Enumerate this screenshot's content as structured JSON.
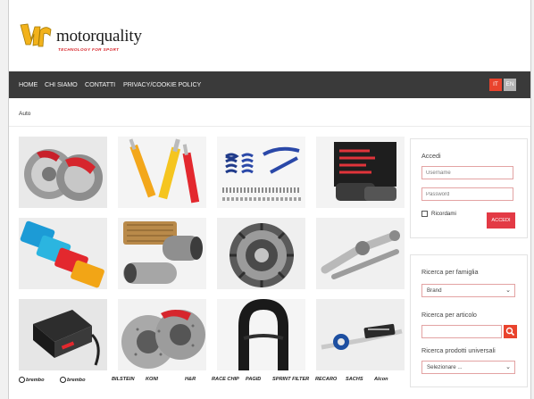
{
  "brand": {
    "name": "motorquality",
    "tagline": "TECHNOLOGY FOR SPORT",
    "accent": "#e9432d"
  },
  "nav": {
    "items": [
      {
        "label": "HOME"
      },
      {
        "label": "CHI SIAMO"
      },
      {
        "label": "CONTATTI"
      },
      {
        "label": "PRIVACY/COOKIE POLICY"
      }
    ],
    "languages": [
      {
        "label": "IT",
        "active": true
      },
      {
        "label": "EN",
        "active": false
      }
    ]
  },
  "breadcrumb": "Auto",
  "products": [
    {
      "icon": "brake-disc-icon"
    },
    {
      "icon": "shock-absorber-icon"
    },
    {
      "icon": "springs-kit-icon"
    },
    {
      "icon": "brake-pads-box-icon"
    },
    {
      "icon": "air-filter-icon"
    },
    {
      "icon": "exhaust-pipe-icon"
    },
    {
      "icon": "clutch-disc-icon"
    },
    {
      "icon": "suspension-arm-icon"
    },
    {
      "icon": "tuning-module-icon"
    },
    {
      "icon": "drilled-rotor-icon"
    },
    {
      "icon": "bucket-seat-icon"
    },
    {
      "icon": "brake-hose-icon"
    }
  ],
  "brands": [
    {
      "label": "brembo",
      "logo": true
    },
    {
      "label": "brembo",
      "logo": true
    },
    {
      "label": "BILSTEIN",
      "logo": false
    },
    {
      "label": "KONI",
      "logo": false
    },
    {
      "label": "H&R",
      "logo": false
    },
    {
      "label": "RACE CHIP",
      "logo": false
    },
    {
      "label": "PAGID",
      "logo": false
    },
    {
      "label": "SPRINT FILTER",
      "logo": false
    },
    {
      "label": "RECARO",
      "logo": false
    },
    {
      "label": "SACHS",
      "logo": false
    },
    {
      "label": "Alcon",
      "logo": false
    }
  ],
  "login": {
    "title": "Accedi",
    "username_placeholder": "Username",
    "password_placeholder": "Password",
    "remember_label": "Ricordami",
    "button_label": "ACCEDI"
  },
  "search": {
    "family_title": "Ricerca per famiglia",
    "family_selected": "Brand",
    "article_title": "Ricerca per articolo",
    "article_value": "",
    "universal_title": "Ricerca prodotti universali",
    "universal_selected": "Selezionare ..."
  }
}
